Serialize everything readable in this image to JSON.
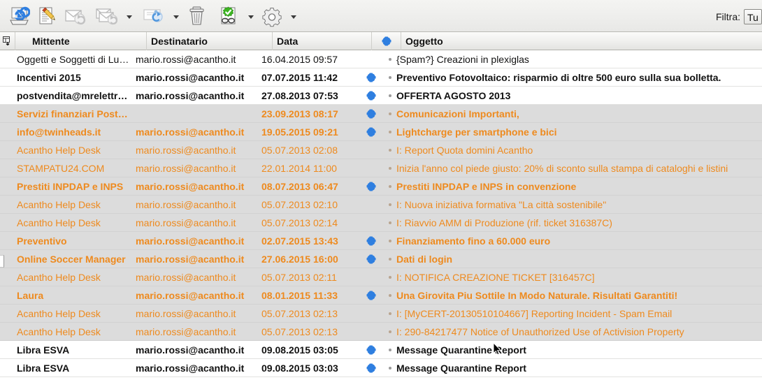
{
  "toolbar": {
    "buttons": [
      {
        "name": "get-mail-button",
        "icon": "refresh-mail-icon",
        "dropdown": false
      },
      {
        "name": "compose-button",
        "icon": "compose-pencil-icon",
        "dropdown": false
      },
      {
        "name": "reply-button",
        "icon": "reply-envelope-icon",
        "dropdown": false
      },
      {
        "name": "reply-all-button",
        "icon": "reply-all-envelope-icon",
        "dropdown": true
      },
      {
        "name": "forward-button",
        "icon": "forward-envelope-icon",
        "dropdown": true
      },
      {
        "name": "delete-button",
        "icon": "trash-icon",
        "dropdown": false
      },
      {
        "name": "junk-button",
        "icon": "spam-check-glasses-icon",
        "dropdown": true
      },
      {
        "name": "settings-button",
        "icon": "gear-icon",
        "dropdown": true
      }
    ],
    "filter_label": "Filtra:",
    "filter_value": "Tu",
    "filter_options": [
      "Tutti"
    ]
  },
  "columns": {
    "sort_icon": "column-chooser-icon",
    "from": "Mittente",
    "to": "Destinatario",
    "date": "Data",
    "flag_icon": "new-message-flag-icon",
    "subject": "Oggetto"
  },
  "colors": {
    "orange": "#ee8a1e",
    "selection": "#dcdcdc",
    "text": "#111111",
    "flag_blue": "#2f7fe0"
  },
  "rows": [
    {
      "from": "Oggetti e Soggetti di Luca…",
      "to": "mario.rossi@acantho.it",
      "date": "16.04.2015 09:57",
      "flag": false,
      "subject": "{Spam?} Creazioni in plexiglas",
      "bold": false,
      "orange": false,
      "selected": false
    },
    {
      "from": "Incentivi 2015",
      "to": "mario.rossi@acantho.it",
      "date": "07.07.2015 11:42",
      "flag": true,
      "subject": "Preventivo Fotovoltaico: risparmio di oltre 500 euro sulla sua bolletta.",
      "bold": true,
      "orange": false,
      "selected": false
    },
    {
      "from": "postvendita@mrelettro…",
      "to": "mario.rossi@acantho.it",
      "date": "27.08.2013 07:53",
      "flag": true,
      "subject": "OFFERTA AGOSTO 2013",
      "bold": true,
      "orange": false,
      "selected": false
    },
    {
      "from": "Servizi finanziari Postep…",
      "to": "",
      "date": "23.09.2013 08:17",
      "flag": true,
      "subject": "Comunicazioni Importanti,",
      "bold": true,
      "orange": true,
      "selected": true
    },
    {
      "from": "info@twinheads.it",
      "to": "mario.rossi@acantho.it",
      "date": "19.05.2015 09:21",
      "flag": true,
      "subject": "Lightcharge per smartphone e bici",
      "bold": true,
      "orange": true,
      "selected": true
    },
    {
      "from": "Acantho Help Desk",
      "to": "mario.rossi@acantho.it",
      "date": "05.07.2013 02:08",
      "flag": false,
      "subject": "I: Report Quota domini Acantho",
      "bold": false,
      "orange": true,
      "selected": true
    },
    {
      "from": "STAMPATU24.COM",
      "to": "mario.rossi@acantho.it",
      "date": "22.01.2014 11:00",
      "flag": false,
      "subject": "Inizia l'anno col piede giusto: 20% di sconto sulla stampa di cataloghi e listini",
      "bold": false,
      "orange": true,
      "selected": true
    },
    {
      "from": "Prestiti INPDAP e INPS",
      "to": "mario.rossi@acantho.it",
      "date": "08.07.2013 06:47",
      "flag": true,
      "subject": "Prestiti INPDAP e INPS in convenzione",
      "bold": true,
      "orange": true,
      "selected": true
    },
    {
      "from": "Acantho Help Desk",
      "to": "mario.rossi@acantho.it",
      "date": "05.07.2013 02:10",
      "flag": false,
      "subject": "I: Nuova iniziativa formativa \"La città sostenibile\"",
      "bold": false,
      "orange": true,
      "selected": true
    },
    {
      "from": "Acantho Help Desk",
      "to": "mario.rossi@acantho.it",
      "date": "05.07.2013 02:14",
      "flag": false,
      "subject": "I: Riavvio AMM di Produzione (rif. ticket 316387C)",
      "bold": false,
      "orange": true,
      "selected": true
    },
    {
      "from": "Preventivo",
      "to": "mario.rossi@acantho.it",
      "date": "02.07.2015 13:43",
      "flag": true,
      "subject": "Finanziamento fino a 60.000 euro",
      "bold": true,
      "orange": true,
      "selected": true
    },
    {
      "from": "Online Soccer Manager",
      "to": "mario.rossi@acantho.it",
      "date": "27.06.2015 16:00",
      "flag": true,
      "subject": "Dati di login",
      "bold": true,
      "orange": true,
      "selected": true
    },
    {
      "from": "Acantho Help Desk",
      "to": "mario.rossi@acantho.it",
      "date": "05.07.2013 02:11",
      "flag": false,
      "subject": "I: NOTIFICA CREAZIONE TICKET [316457C]",
      "bold": false,
      "orange": true,
      "selected": true
    },
    {
      "from": "Laura",
      "to": "mario.rossi@acantho.it",
      "date": "08.01.2015 11:33",
      "flag": true,
      "subject": "Una Girovita Piu Sottile In Modo Naturale. Risultati Garantiti!",
      "bold": true,
      "orange": true,
      "selected": true
    },
    {
      "from": "Acantho Help Desk",
      "to": "mario.rossi@acantho.it",
      "date": "05.07.2013 02:13",
      "flag": false,
      "subject": "I: [MyCERT-20130510104667] Reporting Incident - Spam Email",
      "bold": false,
      "orange": true,
      "selected": true
    },
    {
      "from": "Acantho Help Desk",
      "to": "mario.rossi@acantho.it",
      "date": "05.07.2013 02:13",
      "flag": false,
      "subject": "I: 290-84217477 Notice of Unauthorized Use of Activision Property",
      "bold": false,
      "orange": true,
      "selected": true
    },
    {
      "from": "Libra ESVA",
      "to": "mario.rossi@acantho.it",
      "date": "09.08.2015 03:05",
      "flag": true,
      "subject": "Message Quarantine Report",
      "bold": true,
      "orange": false,
      "selected": false
    },
    {
      "from": "Libra ESVA",
      "to": "mario.rossi@acantho.it",
      "date": "09.08.2015 03:03",
      "flag": true,
      "subject": "Message Quarantine Report",
      "bold": true,
      "orange": false,
      "selected": false
    }
  ]
}
